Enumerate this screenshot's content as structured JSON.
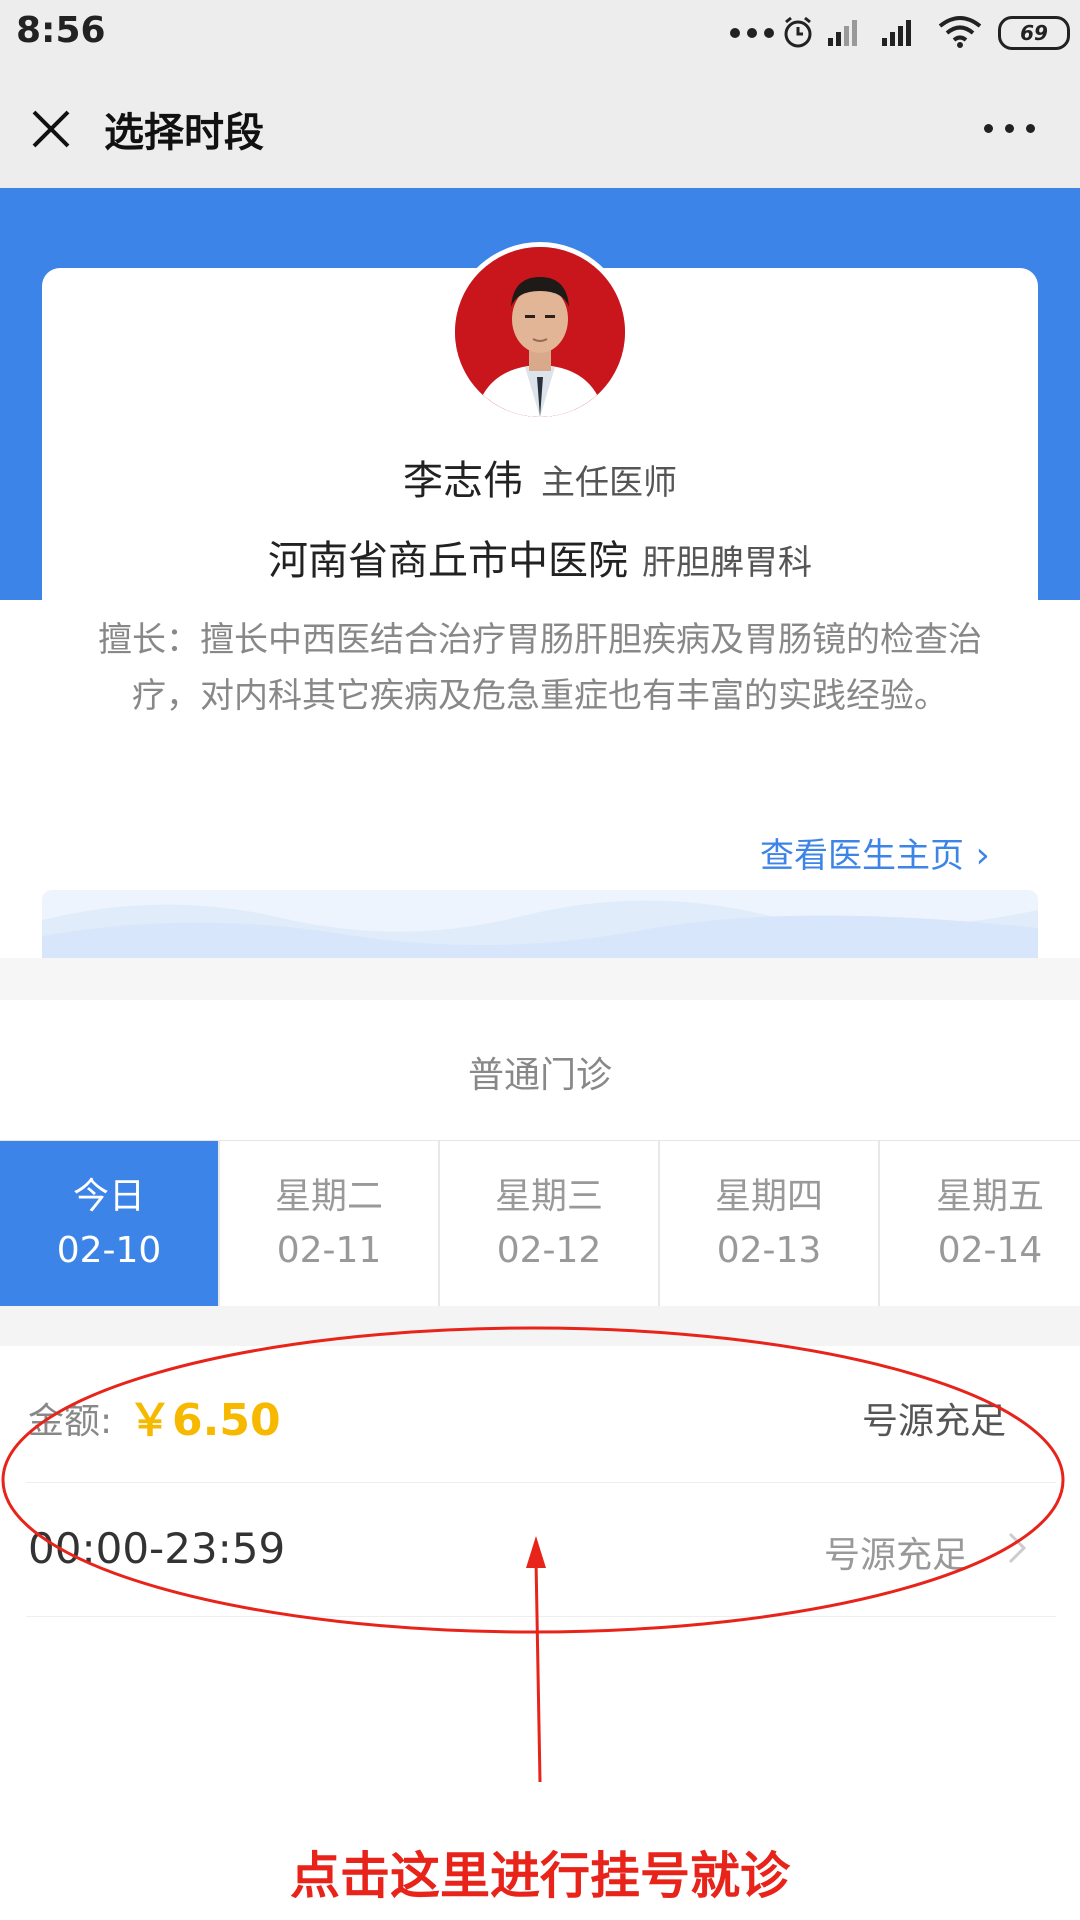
{
  "status_bar": {
    "time": "8:56",
    "battery": "69"
  },
  "header": {
    "title": "选择时段"
  },
  "doctor": {
    "name": "李志伟",
    "title": "主任医师",
    "hospital": "河南省商丘市中医院",
    "department": "肝胆脾胃科",
    "specialty": "擅长：擅长中西医结合治疗胃肠肝胆疾病及胃肠镜的检查治疗，对内科其它疾病及危急重症也有丰富的实践经验。",
    "home_link": "查看医生主页"
  },
  "clinic_type": "普通门诊",
  "days": [
    {
      "weekday": "今日",
      "date": "02-10"
    },
    {
      "weekday": "星期二",
      "date": "02-11"
    },
    {
      "weekday": "星期三",
      "date": "02-12"
    },
    {
      "weekday": "星期四",
      "date": "02-13"
    },
    {
      "weekday": "星期五",
      "date": "02-14"
    }
  ],
  "fee": {
    "label": "金额:",
    "value": "￥6.50"
  },
  "availability": "号源充足",
  "slot": {
    "time": "00:00-23:59",
    "status": "号源充足"
  },
  "annotation": "点击这里进行挂号就诊",
  "colors": {
    "accent": "#3d84e8",
    "price": "#f6b900",
    "annotation": "#e8231a"
  }
}
